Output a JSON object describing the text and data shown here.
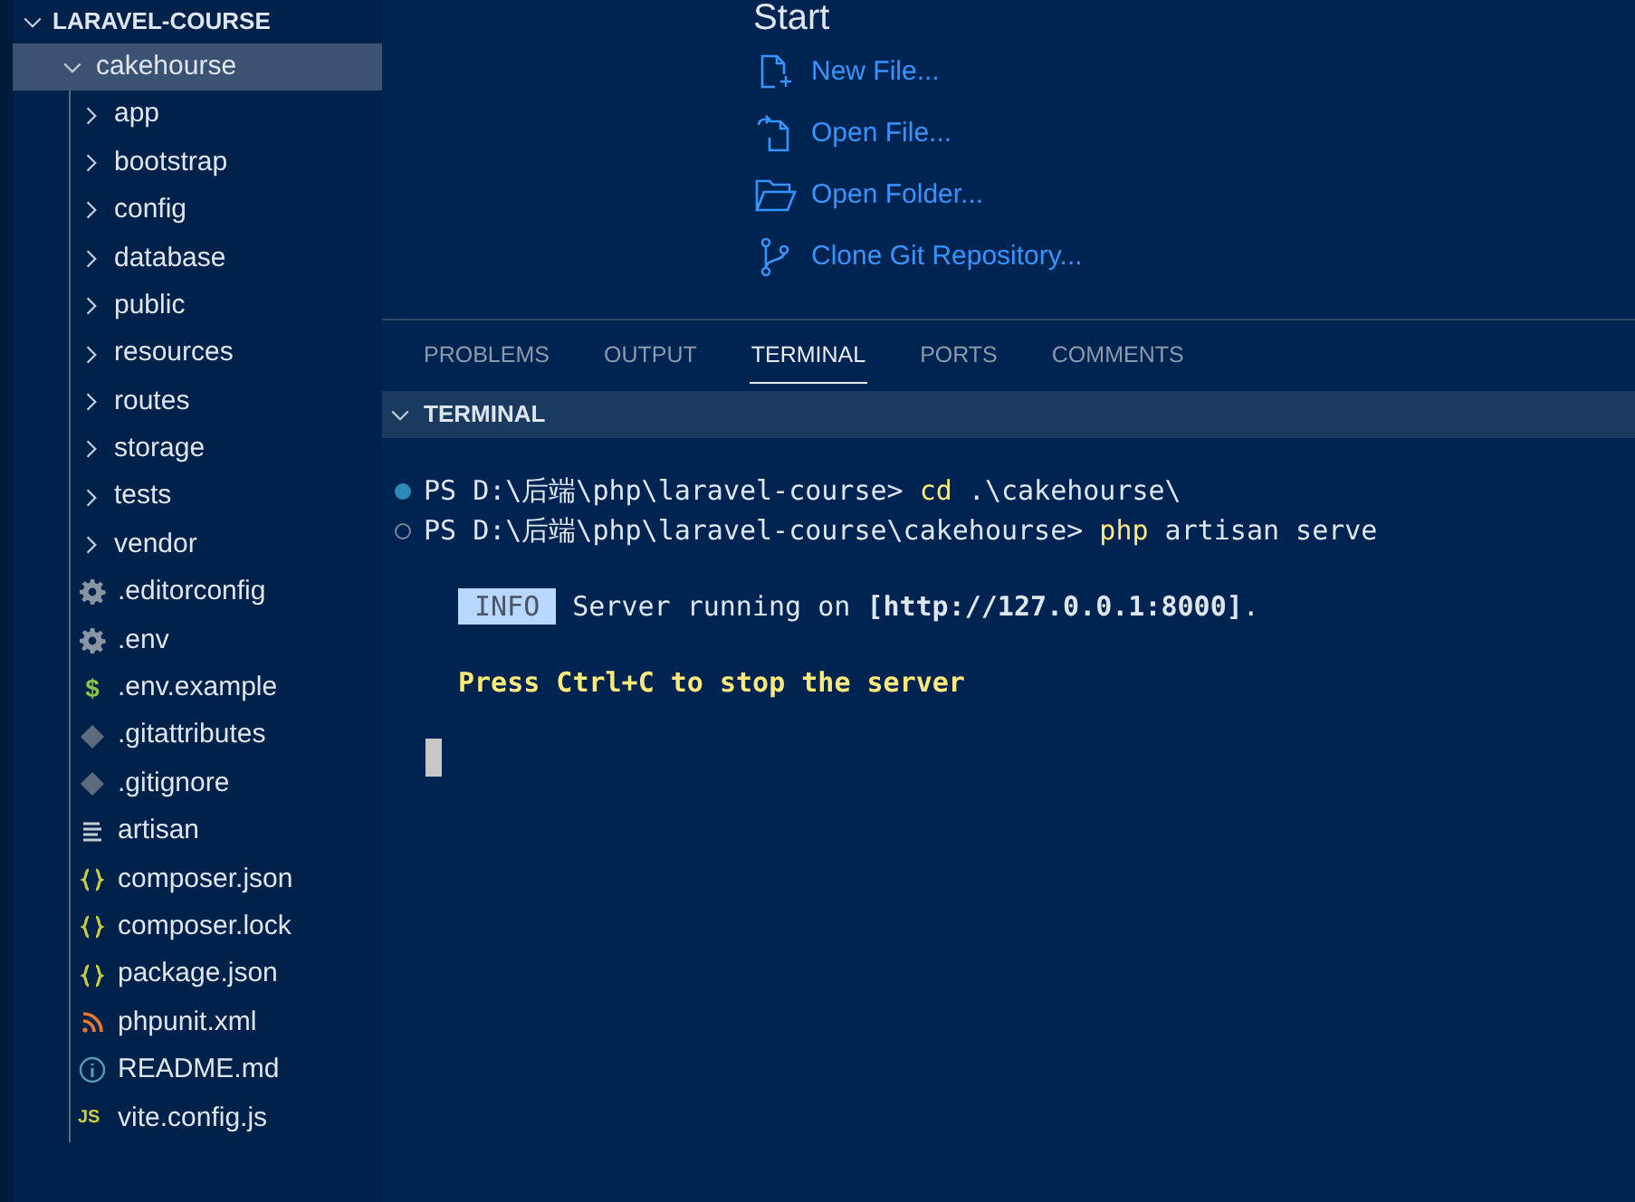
{
  "explorer": {
    "title": "LARAVEL-COURSE",
    "expanded": true,
    "children": [
      {
        "name": "cakehourse",
        "kind": "folder",
        "expanded": true,
        "selected": true,
        "children": [
          {
            "name": "app",
            "kind": "folder",
            "expanded": false
          },
          {
            "name": "bootstrap",
            "kind": "folder",
            "expanded": false
          },
          {
            "name": "config",
            "kind": "folder",
            "expanded": false
          },
          {
            "name": "database",
            "kind": "folder",
            "expanded": false
          },
          {
            "name": "public",
            "kind": "folder",
            "expanded": false
          },
          {
            "name": "resources",
            "kind": "folder",
            "expanded": false
          },
          {
            "name": "routes",
            "kind": "folder",
            "expanded": false
          },
          {
            "name": "storage",
            "kind": "folder",
            "expanded": false
          },
          {
            "name": "tests",
            "kind": "folder",
            "expanded": false
          },
          {
            "name": "vendor",
            "kind": "folder",
            "expanded": false
          },
          {
            "name": ".editorconfig",
            "kind": "gear"
          },
          {
            "name": ".env",
            "kind": "gear"
          },
          {
            "name": ".env.example",
            "kind": "dollar",
            "glyph": "$"
          },
          {
            "name": ".gitattributes",
            "kind": "git"
          },
          {
            "name": ".gitignore",
            "kind": "git"
          },
          {
            "name": "artisan",
            "kind": "lines"
          },
          {
            "name": "composer.json",
            "kind": "braces"
          },
          {
            "name": "composer.lock",
            "kind": "braces"
          },
          {
            "name": "package.json",
            "kind": "braces"
          },
          {
            "name": "phpunit.xml",
            "kind": "feed"
          },
          {
            "name": "README.md",
            "kind": "info"
          },
          {
            "name": "vite.config.js",
            "kind": "js",
            "glyph": "JS"
          }
        ]
      }
    ]
  },
  "start": {
    "title": "Start",
    "actions": [
      {
        "label": "New File...",
        "kind": "new-file"
      },
      {
        "label": "Open File...",
        "kind": "open-file"
      },
      {
        "label": "Open Folder...",
        "kind": "open-folder"
      },
      {
        "label": "Clone Git Repository...",
        "kind": "git"
      }
    ]
  },
  "panel": {
    "tabs": [
      {
        "label": "PROBLEMS",
        "selected": false
      },
      {
        "label": "OUTPUT",
        "selected": false
      },
      {
        "label": "TERMINAL",
        "selected": true
      },
      {
        "label": "PORTS",
        "selected": false
      },
      {
        "label": "COMMENTS",
        "selected": false
      }
    ],
    "section": {
      "title": "TERMINAL",
      "expanded": true
    },
    "terminal": {
      "commands": [
        {
          "completed": true,
          "prompt": "PS D:\\后端\\php\\laravel-course>",
          "command": "cd",
          "args": ".\\cakehourse\\"
        },
        {
          "completed": false,
          "prompt": "PS D:\\后端\\php\\laravel-course\\cakehourse>",
          "command": "php",
          "args": "artisan serve"
        }
      ],
      "info": {
        "badge": "INFO",
        "text": "Server running on ",
        "url": "[http://127.0.0.1:8000]",
        "end": "."
      },
      "hint": "Press Ctrl+C to stop the server"
    }
  }
}
